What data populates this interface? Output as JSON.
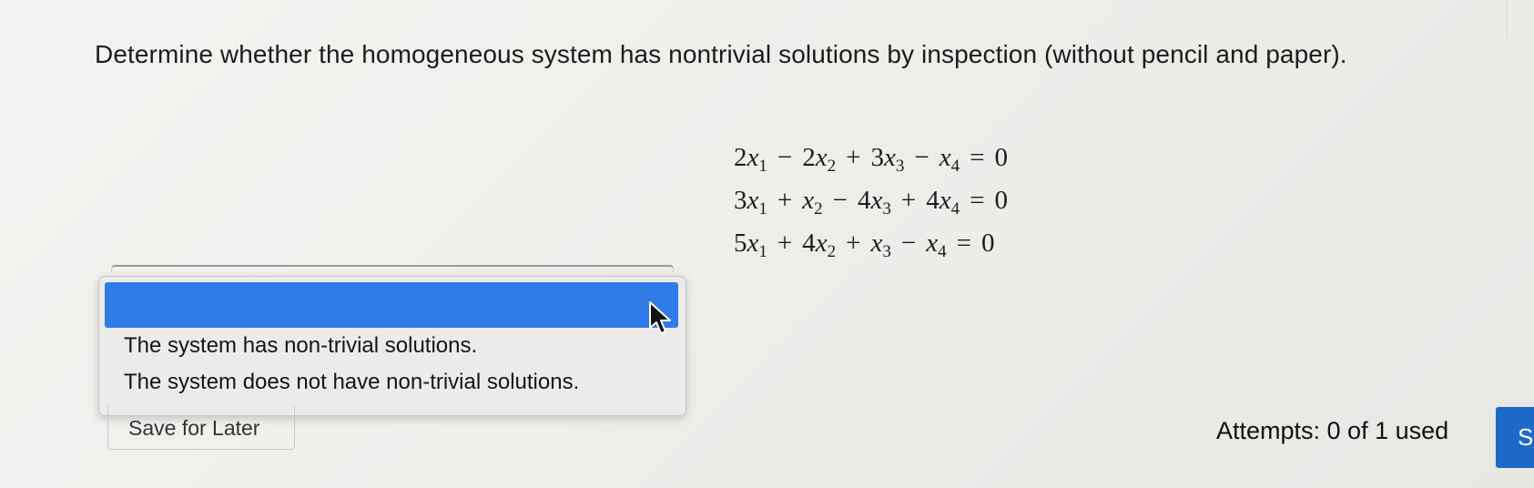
{
  "question": {
    "text": "Determine whether the homogeneous system has nontrivial solutions by inspection (without pencil and paper)."
  },
  "equations": [
    {
      "terms": [
        {
          "op": "",
          "coef": "2",
          "var": "x",
          "sub": "1"
        },
        {
          "op": "−",
          "coef": "2",
          "var": "x",
          "sub": "2"
        },
        {
          "op": "+",
          "coef": "3",
          "var": "x",
          "sub": "3"
        },
        {
          "op": "−",
          "coef": "",
          "var": "x",
          "sub": "4"
        }
      ],
      "rhs": "0"
    },
    {
      "terms": [
        {
          "op": "",
          "coef": "3",
          "var": "x",
          "sub": "1"
        },
        {
          "op": "+",
          "coef": "",
          "var": "x",
          "sub": "2"
        },
        {
          "op": "−",
          "coef": "4",
          "var": "x",
          "sub": "3"
        },
        {
          "op": "+",
          "coef": "4",
          "var": "x",
          "sub": "4"
        }
      ],
      "rhs": "0"
    },
    {
      "terms": [
        {
          "op": "",
          "coef": "5",
          "var": "x",
          "sub": "1"
        },
        {
          "op": "+",
          "coef": "4",
          "var": "x",
          "sub": "2"
        },
        {
          "op": "+",
          "coef": "",
          "var": "x",
          "sub": "3"
        },
        {
          "op": "−",
          "coef": "",
          "var": "x",
          "sub": "4"
        }
      ],
      "rhs": "0"
    }
  ],
  "dropdown": {
    "selected_label": "",
    "options": [
      "The system has non-trivial solutions.",
      "The system does not have non-trivial solutions."
    ],
    "highlight_color": "#2f7be6"
  },
  "footer": {
    "save_label": "Save for Later",
    "attempts": "Attempts: 0 of 1 used",
    "submit_label": "Su"
  },
  "icons": {
    "cursor": "mouse-pointer-icon"
  },
  "colors": {
    "submit_bg": "#1f69c9",
    "background": "#f0efec"
  }
}
